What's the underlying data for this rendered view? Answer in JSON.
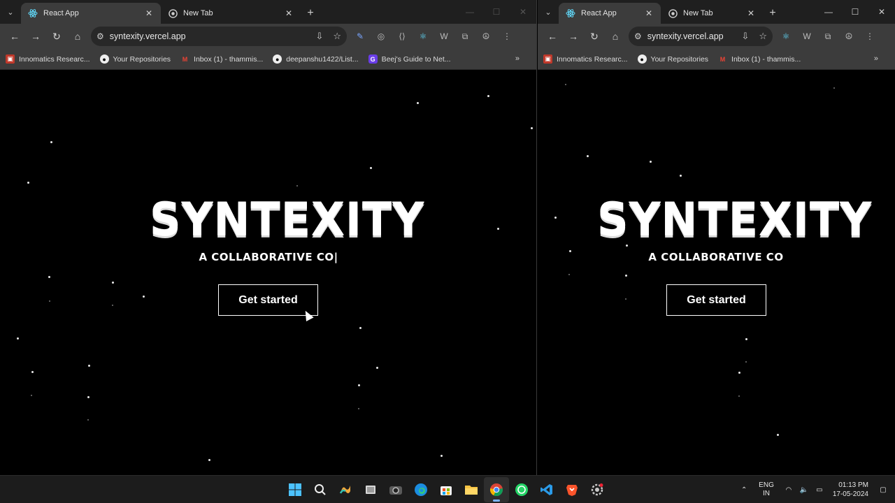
{
  "browser": {
    "tabs": [
      {
        "title": "React App",
        "active": true
      },
      {
        "title": "New Tab",
        "active": false
      }
    ],
    "url": "syntexity.vercel.app",
    "bookmarks_left": [
      "Innomatics Researc...",
      "Your Repositories",
      "Inbox (1) - thammis...",
      "deepanshu1422/List...",
      "Beej's Guide to Net..."
    ],
    "bookmarks_right": [
      "Innomatics Researc...",
      "Your Repositories",
      "Inbox (1) - thammis..."
    ]
  },
  "page": {
    "logo_text": "SYNTEXITY",
    "tagline_left": "A COLLABORATIVE CO|",
    "tagline_right": "A COLLABORATIVE CO",
    "cta_label": "Get started"
  },
  "taskbar": {
    "apps": [
      "windows-start",
      "search",
      "copilot",
      "task-view",
      "camera",
      "edge",
      "store",
      "file-explorer",
      "chrome",
      "whatsapp",
      "vscode",
      "brave",
      "settings"
    ],
    "active_app": "chrome",
    "lang_top": "ENG",
    "lang_bottom": "IN",
    "time": "01:13 PM",
    "date": "17-05-2024"
  },
  "colors": {
    "tabstrip": "#1f1f1f",
    "toolbar": "#3c3c3c",
    "page_bg": "#000000",
    "accent": "#7ab3ff"
  }
}
